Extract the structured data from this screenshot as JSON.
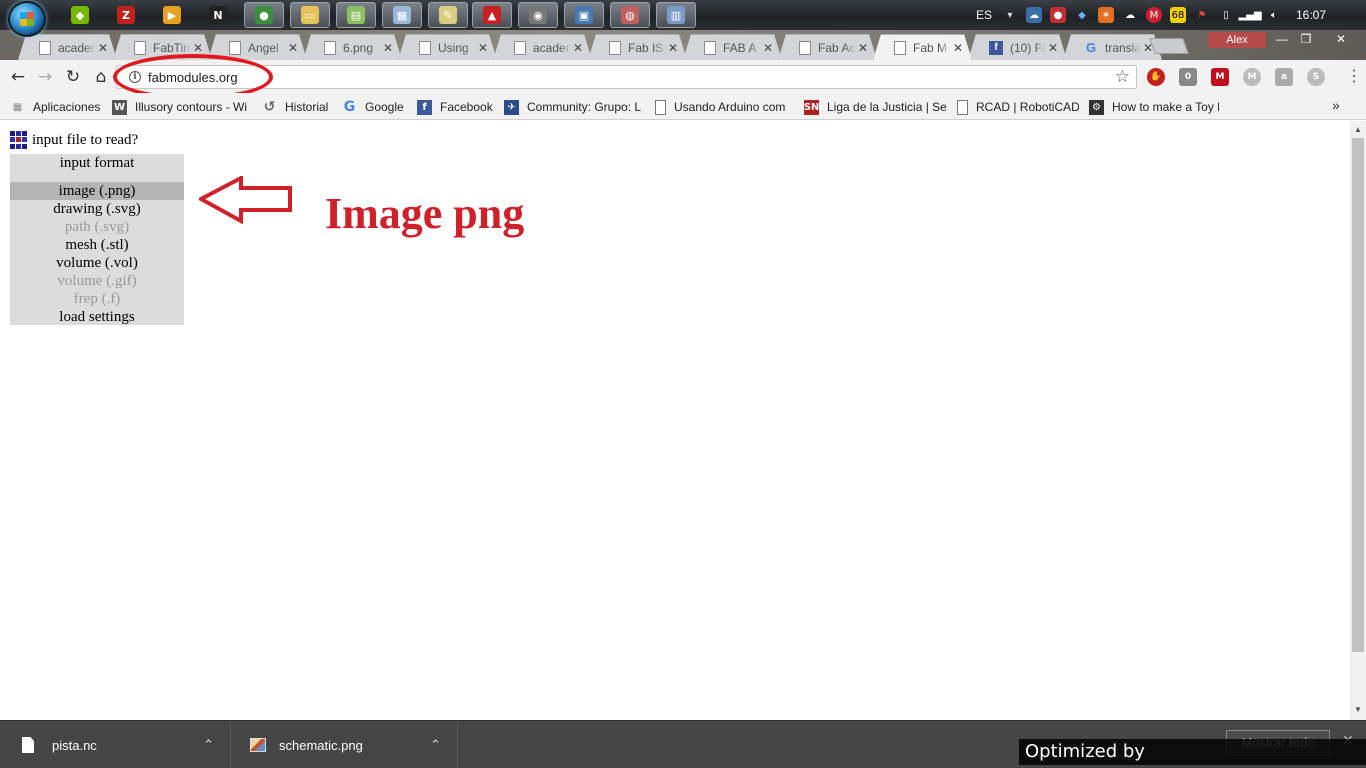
{
  "taskbar": {
    "apps": [
      {
        "icon": "nvidia-icon",
        "glyph": "◆",
        "color": "#76b900"
      },
      {
        "icon": "pcsx2-icon",
        "glyph": "Z",
        "color": "#c02020"
      },
      {
        "icon": "media-player-icon",
        "glyph": "▶",
        "color": "#e8a020"
      },
      {
        "icon": "app-n-icon",
        "glyph": "N",
        "color": "#222222"
      },
      {
        "icon": "chrome-icon",
        "glyph": "●",
        "color": "#3d8f3d"
      },
      {
        "icon": "file-explorer-icon",
        "glyph": "▭",
        "color": "#e6c25a"
      },
      {
        "icon": "notes-icon",
        "glyph": "▤",
        "color": "#8ac060"
      },
      {
        "icon": "notepad-icon",
        "glyph": "▦",
        "color": "#9ab8d8"
      },
      {
        "icon": "editor-icon",
        "glyph": "✎",
        "color": "#d8d080"
      },
      {
        "icon": "acrobat-icon",
        "glyph": "▲",
        "color": "#c82020"
      },
      {
        "icon": "gimp-icon",
        "glyph": "◉",
        "color": "#777777"
      },
      {
        "icon": "window-icon",
        "glyph": "▣",
        "color": "#4a7ab0"
      },
      {
        "icon": "paint-icon",
        "glyph": "◍",
        "color": "#c06060"
      },
      {
        "icon": "calculator-icon",
        "glyph": "▥",
        "color": "#7a9ac8"
      }
    ],
    "language": "ES",
    "badge": "68",
    "clock": "16:07"
  },
  "tabs": [
    {
      "title": "acader",
      "icon": "page"
    },
    {
      "title": "FabTin",
      "icon": "page"
    },
    {
      "title": "Angel",
      "icon": "page"
    },
    {
      "title": "6.png",
      "icon": "page"
    },
    {
      "title": "Using",
      "icon": "page"
    },
    {
      "title": "acader",
      "icon": "page"
    },
    {
      "title": "Fab IS",
      "icon": "page"
    },
    {
      "title": "FAB A",
      "icon": "page"
    },
    {
      "title": "Fab Ac",
      "icon": "page"
    },
    {
      "title": "Fab M",
      "icon": "page",
      "active": true
    },
    {
      "title": "(10) Fa",
      "icon": "fb"
    },
    {
      "title": "transla",
      "icon": "g"
    }
  ],
  "window": {
    "profile": "Alex"
  },
  "address": {
    "url": "fabmodules.org"
  },
  "bookmarks": [
    {
      "label": "Aplicaciones",
      "icon": "apps",
      "color": "#888888",
      "glyph": "▦"
    },
    {
      "label": "Illusory contours - Wi",
      "icon": "wikipedia",
      "color": "#555555",
      "glyph": "W"
    },
    {
      "label": "Historial",
      "icon": "history",
      "color": "#666666",
      "glyph": "↺"
    },
    {
      "label": "Google",
      "icon": "google",
      "color": "#4285f4",
      "glyph": "G"
    },
    {
      "label": "Facebook",
      "icon": "facebook",
      "color": "#3b5998",
      "glyph": "f"
    },
    {
      "label": "Community: Grupo: L",
      "icon": "community",
      "color": "#2a4a8a",
      "glyph": "✈"
    },
    {
      "label": "Usando Arduino com",
      "icon": "page",
      "color": "#ffffff",
      "glyph": ""
    },
    {
      "label": "Liga de la Justicia | Se",
      "icon": "sn",
      "color": "#b02020",
      "glyph": "SN"
    },
    {
      "label": "RCAD | RobotiCAD",
      "icon": "page",
      "color": "#ffffff",
      "glyph": ""
    },
    {
      "label": "How to make a Toy R",
      "icon": "instructables",
      "color": "#333333",
      "glyph": "⚙"
    }
  ],
  "app": {
    "title": "input file to read?",
    "menu_heading": "input format",
    "options": [
      {
        "label": "image (.png)",
        "enabled": true,
        "selected": true
      },
      {
        "label": "drawing (.svg)",
        "enabled": true,
        "selected": false
      },
      {
        "label": "path (.svg)",
        "enabled": false,
        "selected": false
      },
      {
        "label": "mesh (.stl)",
        "enabled": true,
        "selected": false
      },
      {
        "label": "volume (.vol)",
        "enabled": true,
        "selected": false
      },
      {
        "label": "volume (.gif)",
        "enabled": false,
        "selected": false
      },
      {
        "label": "frep (.f)",
        "enabled": false,
        "selected": false
      },
      {
        "label": "load settings",
        "enabled": true,
        "selected": false
      }
    ]
  },
  "annotation": {
    "text": "Image png",
    "color": "#d0202a"
  },
  "downloads": {
    "items": [
      {
        "name": "pista.nc",
        "type": "file"
      },
      {
        "name": "schematic.png",
        "type": "image"
      }
    ],
    "show_all": "Mostrar todo"
  },
  "watermark": "Optimized by www.ImageOptimizer.net"
}
